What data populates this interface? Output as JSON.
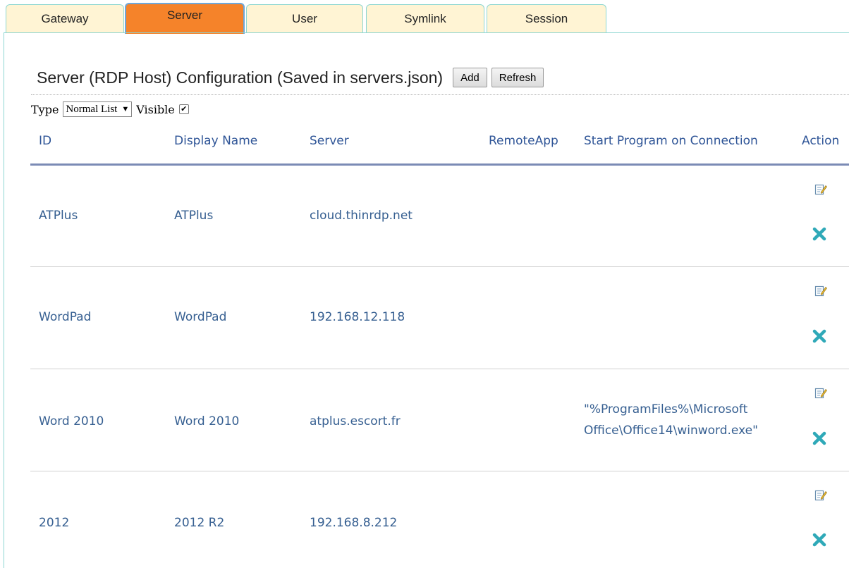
{
  "tabs": [
    {
      "label": "Gateway",
      "active": false
    },
    {
      "label": "Server",
      "active": true
    },
    {
      "label": "User",
      "active": false
    },
    {
      "label": "Symlink",
      "active": false
    },
    {
      "label": "Session",
      "active": false
    }
  ],
  "page": {
    "title": "Server (RDP Host) Configuration (Saved in servers.json)",
    "add_label": "Add",
    "refresh_label": "Refresh"
  },
  "filter": {
    "type_label": "Type",
    "type_value": "Normal List",
    "visible_label": "Visible",
    "visible_checked": true
  },
  "table": {
    "headers": {
      "id": "ID",
      "display_name": "Display Name",
      "server": "Server",
      "remote_app": "RemoteApp",
      "start_program": "Start Program on Connection",
      "action": "Action"
    },
    "rows": [
      {
        "id": "ATPlus",
        "display_name": "ATPlus",
        "server": "cloud.thinrdp.net",
        "remote_app": "",
        "start_program_line1": "",
        "start_program_line2": ""
      },
      {
        "id": "WordPad",
        "display_name": "WordPad",
        "server": "192.168.12.118",
        "remote_app": "",
        "start_program_line1": "",
        "start_program_line2": ""
      },
      {
        "id": "Word 2010",
        "display_name": "Word 2010",
        "server": "atplus.escort.fr",
        "remote_app": "",
        "start_program_line1": "\"%ProgramFiles%\\Microsoft",
        "start_program_line2": "Office\\Office14\\winword.exe\""
      },
      {
        "id": "2012",
        "display_name": "2012 R2",
        "server": "192.168.8.212",
        "remote_app": "",
        "start_program_line1": "",
        "start_program_line2": ""
      }
    ]
  },
  "colors": {
    "tab_bg": "#fff4d4",
    "tab_active_bg": "#f5832a",
    "tab_border": "#8dd6d1",
    "header_text": "#2f5597",
    "cell_text": "#365f91",
    "delete_icon": "#2fa9b8"
  },
  "icons": {
    "edit": "edit-icon",
    "delete": "delete-icon"
  }
}
